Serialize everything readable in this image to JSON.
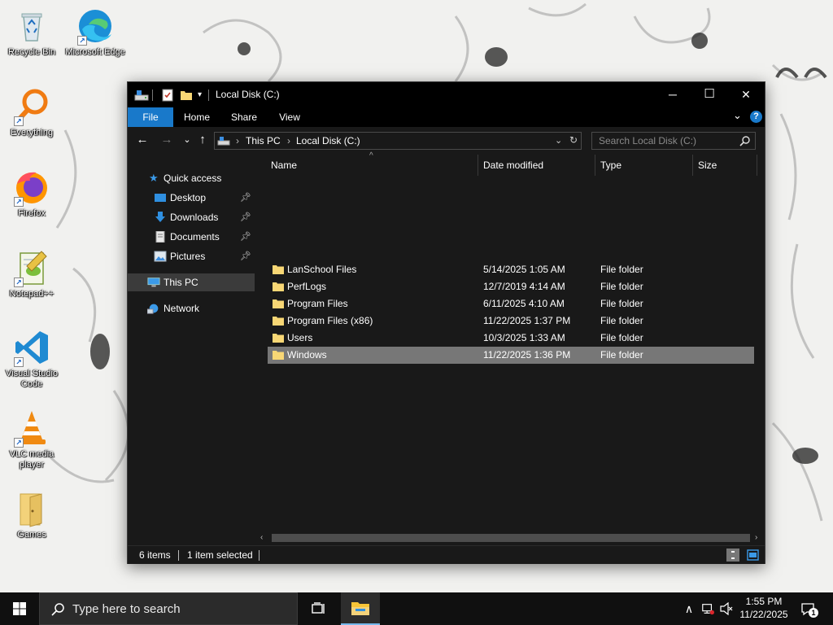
{
  "desktop": {
    "icons": [
      {
        "label": "Recycle Bin"
      },
      {
        "label": "Microsoft Edge"
      },
      {
        "label": "Everything"
      },
      {
        "label": "Firefox"
      },
      {
        "label": "Notepad++"
      },
      {
        "label": "Visual Studio Code"
      },
      {
        "label": "VLC media player"
      },
      {
        "label": "Games"
      }
    ]
  },
  "window": {
    "title": "Local Disk (C:)",
    "controls": {
      "minimize": "─",
      "maximize": "☐",
      "close": "✕"
    },
    "ribbon_tabs": [
      "File",
      "Home",
      "Share",
      "View"
    ],
    "address": {
      "segments": [
        "This PC",
        "Local Disk (C:)"
      ]
    },
    "search_placeholder": "Search Local Disk (C:)",
    "sidebar": {
      "items": [
        {
          "label": "Quick access",
          "icon": "star-icon"
        },
        {
          "label": "Desktop",
          "icon": "desktop-folder-icon",
          "pinned": true
        },
        {
          "label": "Downloads",
          "icon": "download-arrow-icon",
          "pinned": true
        },
        {
          "label": "Documents",
          "icon": "document-icon",
          "pinned": true
        },
        {
          "label": "Pictures",
          "icon": "picture-icon",
          "pinned": true
        },
        {
          "label": "This PC",
          "icon": "computer-icon",
          "selected": true
        },
        {
          "label": "Network",
          "icon": "network-icon"
        }
      ]
    },
    "columns": [
      "Name",
      "Date modified",
      "Type",
      "Size"
    ],
    "rows": [
      {
        "name": "LanSchool Files",
        "date": "5/14/2025 1:05 AM",
        "type": "File folder"
      },
      {
        "name": "PerfLogs",
        "date": "12/7/2019 4:14 AM",
        "type": "File folder"
      },
      {
        "name": "Program Files",
        "date": "6/11/2025 4:10 AM",
        "type": "File folder"
      },
      {
        "name": "Program Files (x86)",
        "date": "11/22/2025 1:37 PM",
        "type": "File folder"
      },
      {
        "name": "Users",
        "date": "10/3/2025 1:33 AM",
        "type": "File folder"
      },
      {
        "name": "Windows",
        "date": "11/22/2025 1:36 PM",
        "type": "File folder",
        "selected": true
      }
    ],
    "status": {
      "items": "6 items",
      "selected": "1 item selected"
    }
  },
  "taskbar": {
    "search_placeholder": "Type here to search",
    "clock": {
      "time": "1:55 PM",
      "date": "11/22/2025"
    },
    "notification_count": "1"
  },
  "colors": {
    "file_tab": "#1979ca",
    "window_bg": "#191919",
    "selected_row": "#777777",
    "folder_yellow": "#f8d775"
  }
}
